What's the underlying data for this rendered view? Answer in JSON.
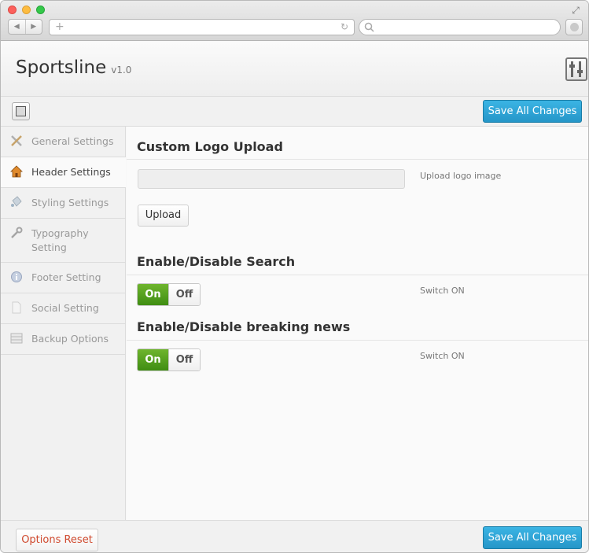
{
  "browser": {
    "back_icon": "back-arrow-icon",
    "forward_icon": "forward-arrow-icon",
    "new_tab_icon": "plus-icon",
    "reload_icon": "reload-icon",
    "search_icon": "magnifier-icon"
  },
  "header": {
    "brand": "Sportsline",
    "version": "v1.0"
  },
  "toolbar": {
    "save_label": "Save All Changes"
  },
  "sidebar": {
    "items": [
      {
        "label": "General Settings",
        "icon": "tools-icon",
        "active": false
      },
      {
        "label": "Header Settings",
        "icon": "home-icon",
        "active": true
      },
      {
        "label": "Styling Settings",
        "icon": "paint-bucket-icon",
        "active": false
      },
      {
        "label": "Typography Setting",
        "icon": "wrench-icon",
        "active": false
      },
      {
        "label": "Footer Setting",
        "icon": "info-icon",
        "active": false
      },
      {
        "label": "Social Setting",
        "icon": "document-icon",
        "active": false
      },
      {
        "label": "Backup Options",
        "icon": "list-icon",
        "active": false
      }
    ]
  },
  "main": {
    "logo_section": {
      "title": "Custom Logo Upload",
      "input_value": "",
      "description": "Upload logo image",
      "upload_label": "Upload"
    },
    "search_section": {
      "title": "Enable/Disable Search",
      "on_label": "On",
      "off_label": "Off",
      "description": "Switch ON",
      "state": "on"
    },
    "news_section": {
      "title": "Enable/Disable breaking news",
      "on_label": "On",
      "off_label": "Off",
      "description": "Switch ON",
      "state": "on"
    }
  },
  "footer": {
    "reset_label": "Options Reset",
    "save_label": "Save All Changes"
  },
  "colors": {
    "primary_button": "#2596c8",
    "switch_on": "#4f9e1c",
    "reset_text": "#d04a2f"
  }
}
